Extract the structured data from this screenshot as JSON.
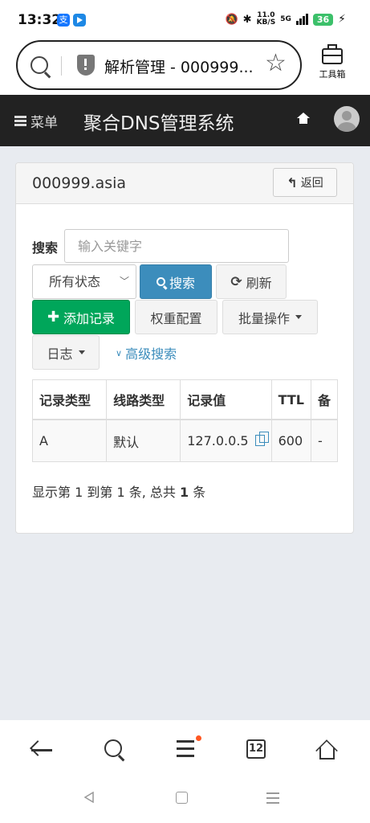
{
  "status_bar": {
    "time": "13:32",
    "app_icon1_glyph": "支",
    "speed_value": "11.0",
    "speed_unit": "KB/S",
    "network": "5G",
    "battery": "36",
    "icons": [
      "mute-icon",
      "bluetooth-icon",
      "signal-icon",
      "battery-icon",
      "charging-icon"
    ]
  },
  "browser": {
    "url_title": "解析管理 - 000999...",
    "toolbox_label": "工具箱"
  },
  "navbar": {
    "menu_label": "菜单",
    "app_title": "聚合DNS管理系统"
  },
  "panel": {
    "domain": "000999.asia",
    "back_label": "返回"
  },
  "search": {
    "label": "搜索",
    "placeholder": "输入关键字",
    "status_selected": "所有状态",
    "search_button": "搜索",
    "refresh_button": "刷新"
  },
  "actions": {
    "add_record": "添加记录",
    "weight_config": "权重配置",
    "batch_ops": "批量操作",
    "log": "日志",
    "advanced_search": "高级搜索"
  },
  "table": {
    "headers": [
      "记录类型",
      "线路类型",
      "记录值",
      "TTL",
      "备"
    ],
    "rows": [
      [
        "A",
        "默认",
        "127.0.0.5",
        "600",
        "-"
      ]
    ]
  },
  "summary": {
    "prefix": "显示第 1 到第 1 条, 总共 ",
    "total": "1",
    "suffix": " 条"
  },
  "bottom_nav": {
    "tabs_count": "12"
  },
  "colors": {
    "primary": "#3c8dbc",
    "success": "#00a65a",
    "navbar": "#222222",
    "page_bg": "#e8ebf0"
  }
}
